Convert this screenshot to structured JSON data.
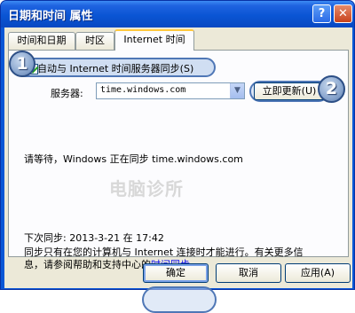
{
  "window": {
    "title": "日期和时间 属性",
    "help_label": "?",
    "close_label": "✕"
  },
  "tabs": [
    {
      "label": "时间和日期"
    },
    {
      "label": "时区"
    },
    {
      "label": "Internet 时间"
    }
  ],
  "internet_time": {
    "auto_sync_label": "自动与 Internet 时间服务器同步(S)",
    "auto_sync_checked": true,
    "server_label": "服务器:",
    "server_value": "time.windows.com",
    "update_now_label": "立即更新(U)",
    "status_text": "请等待，Windows 正在同步 time.windows.com",
    "watermark": "电脑诊所",
    "next_sync_text": "下次同步: 2013-3-21 在 17:42",
    "info_line1": "同步只有在您的计算机与 Internet 连接时才能进行。有关更多信",
    "info_line2_prefix": "息，请参阅帮助和支持中心的",
    "info_line2_link": "时间同步",
    "info_line2_suffix": "。"
  },
  "annotations": {
    "badge1": "1",
    "badge2": "2"
  },
  "buttons": {
    "ok": "确定",
    "cancel": "取消",
    "apply": "应用(A)"
  },
  "colors": {
    "titlebar": "#0a55d4",
    "dialog_bg": "#ece9d8",
    "highlight_border": "#4f77b6",
    "link": "#0000ee"
  }
}
